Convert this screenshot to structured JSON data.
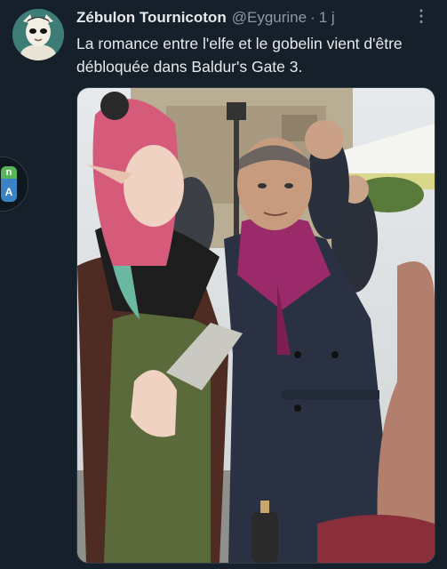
{
  "tweet": {
    "author_name": "Zébulon Tournicoton",
    "handle": "@Eygurine",
    "separator": "·",
    "time": "1 j",
    "more_icon": "more-dots-icon",
    "text": "La romance entre l'elfe et le gobelin vient d'être débloquée dans Baldur's Gate 3."
  },
  "side_badge": {
    "top_glyph": "n",
    "bottom_glyph": "A"
  },
  "colors": {
    "background": "#15202b",
    "text": "#e7e9ea",
    "muted": "#8b98a5"
  }
}
